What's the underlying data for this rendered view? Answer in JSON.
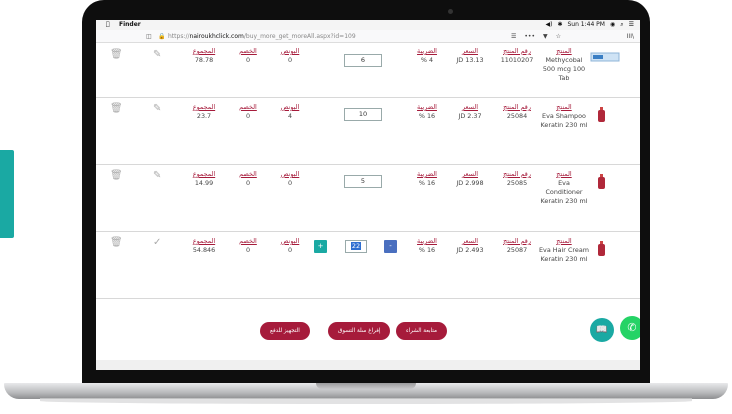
{
  "menubar": {
    "apple": "",
    "app": "Finder",
    "wifi": "◉",
    "bt": "✱",
    "volume": "◀)",
    "time": "Sun 1:44 PM",
    "search": "⌕",
    "menu": "☰"
  },
  "browser": {
    "url_prefix": "https://",
    "url_host": "nairoukhclick.com",
    "url_path": "/buy_more_get_moreAll.aspx?id=109",
    "reader": "☰",
    "more": "•••",
    "pocket": "▼",
    "star": "☆",
    "library": "III\\"
  },
  "labels": {
    "product": "المنتج",
    "code": "رقم المنتج",
    "price": "السعر",
    "tax": "الضريبة",
    "bonus": "البونص",
    "discount": "الخصم",
    "total": "المجموع"
  },
  "rows": [
    {
      "name": "Methycobal 500 mcg 100 Tab",
      "code": "11010207",
      "price": "JD 13.13",
      "tax": "% 4",
      "qty": "6",
      "bonus": "0",
      "discount": "0",
      "total": "78.78"
    },
    {
      "name": "Eva Shampoo Keratin 230 ml",
      "code": "25084",
      "price": "JD 2.37",
      "tax": "% 16",
      "qty": "10",
      "bonus": "4",
      "discount": "0",
      "total": "23.7"
    },
    {
      "name": "Eva Conditioner Keratin 230 ml",
      "code": "25085",
      "price": "JD 2.998",
      "tax": "% 16",
      "qty": "5",
      "bonus": "0",
      "discount": "0",
      "total": "14.99"
    },
    {
      "name": "Eva Hair Cream Keratin 230 ml",
      "code": "25087",
      "price": "JD 2.493",
      "tax": "% 16",
      "qty": "22",
      "bonus": "0",
      "discount": "0",
      "total": "54.846"
    }
  ],
  "buttons": {
    "continue": "متابعة الشراء",
    "empty": "إفراغ سلة التسوق",
    "checkout": "التجهيز للدفع",
    "plus": "+",
    "minus": "-"
  },
  "colors": {
    "brand": "#a61b3b",
    "teal": "#1aa9a3",
    "blue": "#4a6fbf",
    "whatsapp": "#25d366"
  }
}
